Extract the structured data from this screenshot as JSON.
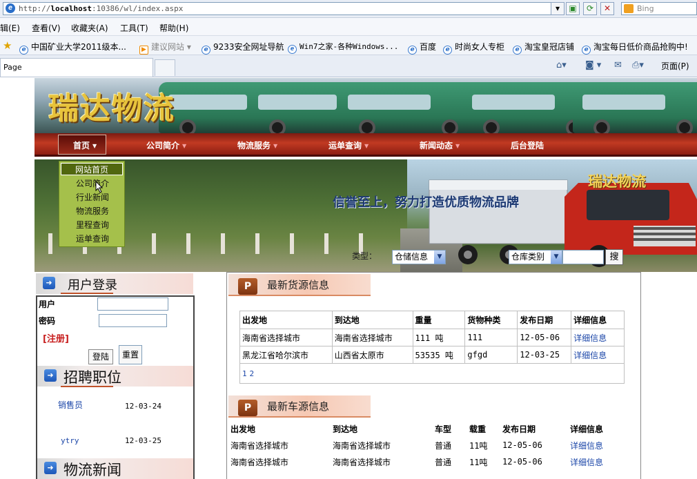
{
  "browser": {
    "url_prefix": "http://",
    "url_host": "localhost",
    "url_rest": ":10386/wl/index.aspx",
    "search_engine": "Bing",
    "menu": [
      "辑(E)",
      "查看(V)",
      "收藏夹(A)",
      "工具(T)",
      "帮助(H)"
    ],
    "favorites": [
      "中国矿业大学2011级本...",
      "建议网站",
      "9233安全网址导航",
      "Win7之家-各种Windows...",
      "百度",
      "时尚女人专柜",
      "淘宝皇冠店铺",
      "淘宝每日低价商品抢购中!"
    ],
    "tab_title": "Page",
    "page_menu": "页面(P)"
  },
  "site": {
    "logo": "瑞达物流",
    "hero_logo": "瑞达物流",
    "slogan": "信誉至上，努力打造优质物流品牌"
  },
  "nav": {
    "items": [
      "首页",
      "公司简介",
      "物流服务",
      "运单查询",
      "新闻动态",
      "后台登陆"
    ],
    "dropdown": [
      "网站首页",
      "公司简介",
      "行业新闻",
      "物流服务",
      "里程查询",
      "运单查询"
    ]
  },
  "search": {
    "type_label": "类型：",
    "type_value": "仓储信息",
    "category_value": "仓库类别",
    "button": "搜"
  },
  "login": {
    "title": "用户登录",
    "user_label": "用户",
    "password_label": "密码",
    "register": "[注册]",
    "login_button": "登陆",
    "reset_button": "重置"
  },
  "jobs": {
    "title": "招聘职位",
    "items": [
      {
        "name": "销售员",
        "date": "12-03-24"
      },
      {
        "name": "ytry",
        "date": "12-03-25"
      }
    ]
  },
  "news": {
    "title": "物流新闻"
  },
  "cargo": {
    "title": "最新货源信息",
    "headers": [
      "出发地",
      "到达地",
      "重量",
      "货物种类",
      "发布日期",
      "详细信息"
    ],
    "rows": [
      [
        "海南省选择城市",
        "海南省选择城市",
        "111 吨",
        "111",
        "12-05-06",
        "详细信息"
      ],
      [
        "黑龙江省哈尔滨市",
        "山西省太原市",
        "53535 吨",
        "gfgd",
        "12-03-25",
        "详细信息"
      ]
    ],
    "pages": [
      "1",
      "2"
    ]
  },
  "vehicles": {
    "title": "最新车源信息",
    "headers": [
      "出发地",
      "到达地",
      "车型",
      "载重",
      "发布日期",
      "详细信息"
    ],
    "rows": [
      [
        "海南省选择城市",
        "海南省选择城市",
        "普通",
        "11吨",
        "12-05-06",
        "详细信息"
      ],
      [
        "海南省选择城市",
        "海南省选择城市",
        "普通",
        "11吨",
        "12-05-06",
        "详细信息"
      ]
    ]
  }
}
